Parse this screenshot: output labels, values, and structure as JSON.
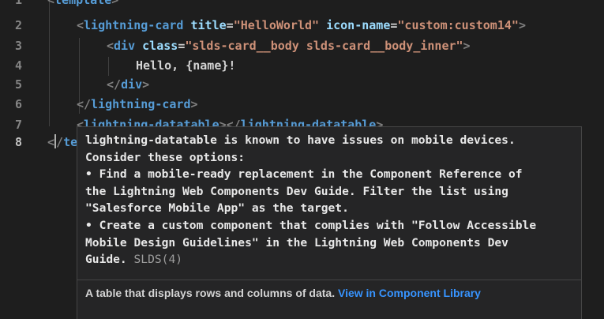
{
  "editor": {
    "lines": [
      {
        "number": "1",
        "tokens": [
          {
            "t": "<",
            "c": "t-punc"
          },
          {
            "t": "template",
            "c": "t-tag"
          },
          {
            "t": ">",
            "c": "t-punc"
          }
        ]
      },
      {
        "number": "2",
        "tokens": [
          {
            "t": "<",
            "c": "t-punc"
          },
          {
            "t": "lightning-card",
            "c": "t-tag"
          },
          {
            "t": " ",
            "c": "t-text"
          },
          {
            "t": "title",
            "c": "t-attr"
          },
          {
            "t": "=",
            "c": "t-text"
          },
          {
            "t": "\"HelloWorld\"",
            "c": "t-str"
          },
          {
            "t": " ",
            "c": "t-text"
          },
          {
            "t": "icon-name",
            "c": "t-attr"
          },
          {
            "t": "=",
            "c": "t-text"
          },
          {
            "t": "\"custom:custom14\"",
            "c": "t-str"
          },
          {
            "t": ">",
            "c": "t-punc"
          }
        ]
      },
      {
        "number": "3",
        "tokens": [
          {
            "t": "<",
            "c": "t-punc"
          },
          {
            "t": "div",
            "c": "t-tag"
          },
          {
            "t": " ",
            "c": "t-text"
          },
          {
            "t": "class",
            "c": "t-attr"
          },
          {
            "t": "=",
            "c": "t-text"
          },
          {
            "t": "\"slds-card__body slds-card__body_inner\"",
            "c": "t-str"
          },
          {
            "t": ">",
            "c": "t-punc"
          }
        ]
      },
      {
        "number": "4",
        "tokens": [
          {
            "t": "Hello, {name}!",
            "c": "t-text"
          }
        ]
      },
      {
        "number": "5",
        "tokens": [
          {
            "t": "</",
            "c": "t-punc"
          },
          {
            "t": "div",
            "c": "t-tag"
          },
          {
            "t": ">",
            "c": "t-punc"
          }
        ]
      },
      {
        "number": "6",
        "tokens": [
          {
            "t": "</",
            "c": "t-punc"
          },
          {
            "t": "lightning-card",
            "c": "t-tag"
          },
          {
            "t": ">",
            "c": "t-punc"
          }
        ]
      },
      {
        "number": "7",
        "tokens": [
          {
            "t": "<",
            "c": "t-punc",
            "sq": true
          },
          {
            "t": "lightning-datatable",
            "c": "t-tag",
            "sq": true
          },
          {
            "t": "></",
            "c": "t-punc",
            "sq": true
          },
          {
            "t": "lightning-datatable",
            "c": "t-tag",
            "sq": true
          },
          {
            "t": ">",
            "c": "t-punc",
            "sq": true
          }
        ]
      },
      {
        "number": "8",
        "tokens": [
          {
            "t": "<",
            "c": "t-punc"
          },
          {
            "cursor": true
          },
          {
            "t": "/",
            "c": "t-punc"
          },
          {
            "t": "te",
            "c": "t-tag"
          }
        ]
      }
    ]
  },
  "hover": {
    "message": "lightning-datatable is known to have issues on mobile devices.\nConsider these options:\n• Find a mobile-ready replacement in the Component Reference of\nthe Lightning Web Components Dev Guide. Filter the list using\n\"Salesforce Mobile App\" as the target.\n• Create a custom component that complies with \"Follow Accessible\nMobile Design Guidelines\" in the Lightning Web Components Dev\nGuide. ",
    "source": "SLDS(4)",
    "footer_text": "A table that displays rows and columns of data. ",
    "link_text": "View in Component Library"
  },
  "colors": {
    "background": "#1e1e1e",
    "tag": "#569cd6",
    "attribute": "#9cdcfe",
    "string": "#ce9178",
    "warning": "#cca700",
    "link": "#3794ff"
  }
}
